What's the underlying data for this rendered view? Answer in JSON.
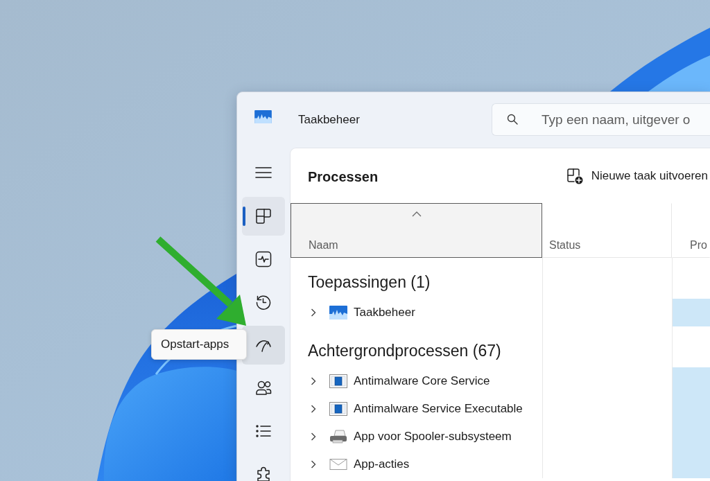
{
  "window": {
    "title": "Taakbeheer",
    "search": {
      "placeholder": "Typ een naam, uitgever o"
    }
  },
  "nav": {
    "items": [
      {
        "kind": "processes",
        "selected": true,
        "hovered": false
      },
      {
        "kind": "performance",
        "selected": false,
        "hovered": false
      },
      {
        "kind": "history",
        "selected": false,
        "hovered": false
      },
      {
        "kind": "startup",
        "selected": false,
        "hovered": true
      },
      {
        "kind": "users",
        "selected": false,
        "hovered": false
      },
      {
        "kind": "details",
        "selected": false,
        "hovered": false
      },
      {
        "kind": "services",
        "selected": false,
        "hovered": false
      }
    ]
  },
  "tooltip": {
    "text": "Opstart-apps"
  },
  "panel": {
    "title": "Processen",
    "action": {
      "label": "Nieuwe taak uitvoeren"
    }
  },
  "table": {
    "columns": [
      {
        "label": "Naam",
        "sorted": true,
        "hovered": true
      },
      {
        "label": "Status",
        "sorted": false,
        "hovered": false
      },
      {
        "label": "Pro",
        "sorted": false,
        "hovered": false
      }
    ],
    "groups": [
      {
        "title": "Toepassingen (1)",
        "rows": [
          {
            "name": "Taakbeheer",
            "kind": "taskmanager",
            "expanded": false,
            "shaded": true
          }
        ]
      },
      {
        "title": "Achtergrondprocessen (67)",
        "rows": [
          {
            "name": "Antimalware Core Service",
            "kind": "service",
            "expanded": false,
            "shaded": true
          },
          {
            "name": "Antimalware Service Executable",
            "kind": "service",
            "expanded": false,
            "shaded": true
          },
          {
            "name": "App voor Spooler-subsysteem",
            "kind": "printer",
            "expanded": false,
            "shaded": true
          },
          {
            "name": "App-acties",
            "kind": "mail",
            "expanded": false,
            "shaded": true
          }
        ]
      }
    ]
  }
}
